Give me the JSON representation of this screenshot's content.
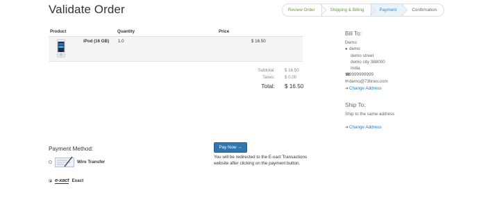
{
  "page": {
    "title": "Validate Order"
  },
  "wizard": {
    "steps": [
      {
        "label": "Review Order",
        "state": "done"
      },
      {
        "label": "Shipping & Billing",
        "state": "done"
      },
      {
        "label": "Payment",
        "state": "active"
      },
      {
        "label": "Confirmation",
        "state": "todo"
      }
    ]
  },
  "order": {
    "headers": {
      "product": "Product",
      "quantity": "Quantity",
      "price": "Price"
    },
    "items": [
      {
        "name": "iPod (16 GB)",
        "quantity": "1.0",
        "price": "$ 16.50"
      }
    ],
    "subtotal_label": "Subtotal:",
    "subtotal_value": "$ 16.50",
    "taxes_label": "Taxes:",
    "taxes_value": "$ 0.00",
    "total_label": "Total:",
    "total_value": "$ 16.50"
  },
  "bill_to": {
    "title": "Bill To:",
    "name": "Demo",
    "contact": "demo",
    "street": "demo street",
    "city_zip": "demo city 388000",
    "country": "India",
    "phone": "9999999999",
    "email": "demo@73lines.com",
    "change_link": "Change Address"
  },
  "ship_to": {
    "title": "Ship To:",
    "text": "Ship to the same address",
    "change_link": "Change Address"
  },
  "payment": {
    "title": "Payment Method:",
    "methods": [
      {
        "label": "Wire Transfer",
        "selected": false
      },
      {
        "label": "Exact",
        "logo_text": "e-xact",
        "selected": true
      }
    ],
    "pay_button": "Pay Now →",
    "note": "You will be redirected to the E-xact Transactions website after clicking on the payment button."
  },
  "colors": {
    "accent": "#3276b1",
    "link": "#2a7ab8",
    "step_done": "#6a9a3a",
    "step_active_bg": "#e8f3fb"
  }
}
